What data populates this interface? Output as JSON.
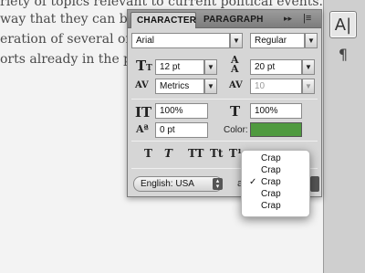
{
  "document": {
    "lines": [
      "riety of topics relevant to current political events. Yet,",
      " way that they can be e",
      "eration of several orga",
      "orts already in the pub"
    ]
  },
  "dock": {
    "character_icon": "A|",
    "paragraph_icon": "¶"
  },
  "panel": {
    "tabs": {
      "character": "CHARACTER",
      "paragraph": "PARAGRAPH"
    },
    "collapse_glyph": "▸▸",
    "menu_glyph": "|≡",
    "font_family": "Arial",
    "font_style": "Regular",
    "font_size": "12 pt",
    "leading": "20 pt",
    "kerning": "Metrics",
    "tracking": "10",
    "vertical_scale": "100%",
    "horizontal_scale": "100%",
    "baseline_shift": "0 pt",
    "color_label": "Color:",
    "color_value": "#4f9a3f",
    "style_buttons": [
      "T",
      "T",
      "TT",
      "Tt",
      "T¹"
    ],
    "language": "English: USA",
    "antialias_label": "a"
  },
  "popup": {
    "options": [
      {
        "label": "Crap",
        "checked": false
      },
      {
        "label": "Crap",
        "checked": false
      },
      {
        "label": "Crap",
        "checked": true
      },
      {
        "label": "Crap",
        "checked": false
      },
      {
        "label": "Crap",
        "checked": false
      }
    ],
    "check_glyph": "✓"
  }
}
